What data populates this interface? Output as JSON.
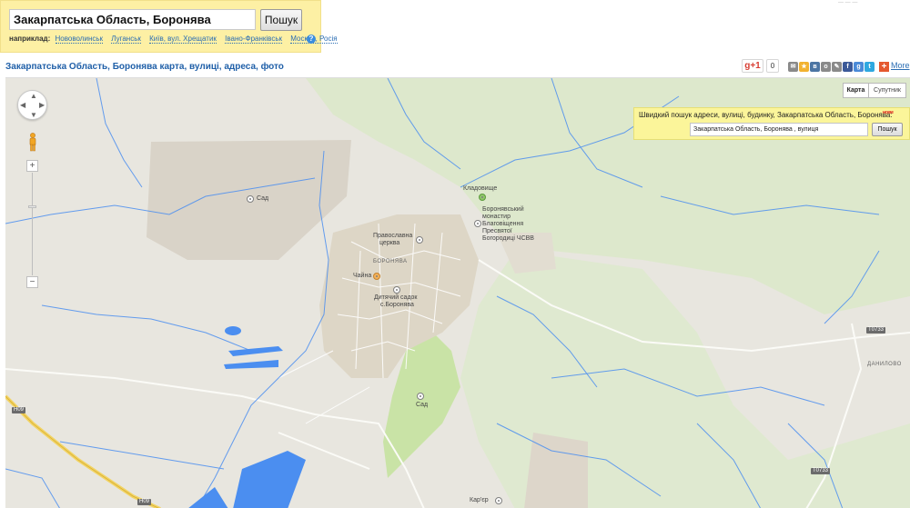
{
  "search": {
    "value": "Закарпатська Область, Боронява",
    "button_label": "Пошук",
    "examples_label": "наприклад:",
    "examples": [
      "Нововолинськ",
      "Луганськ",
      "Київ, вул. Хрещатик",
      "Івано-Франківськ",
      "Москва, Росія"
    ],
    "help_icon": "?"
  },
  "header": {
    "title": "Закарпатська Область, Боронява карта, вулиці, адреса, фото",
    "gplus_label": "g+1",
    "gplus_count": "0",
    "share_icons": [
      {
        "name": "mail-icon",
        "glyph": "✉",
        "color": "#8a8a8a"
      },
      {
        "name": "bookmark-icon",
        "glyph": "★",
        "color": "#f2b230"
      },
      {
        "name": "vk-icon",
        "glyph": "в",
        "color": "#4c75a3"
      },
      {
        "name": "odnoklassniki-icon",
        "glyph": "о",
        "color": "#8a8a8a"
      },
      {
        "name": "livejournal-icon",
        "glyph": "✎",
        "color": "#8a8a8a"
      },
      {
        "name": "facebook-icon",
        "glyph": "f",
        "color": "#3b5998"
      },
      {
        "name": "google-icon",
        "glyph": "g",
        "color": "#4a8ad8"
      },
      {
        "name": "twitter-icon",
        "glyph": "t",
        "color": "#2fa8e0"
      }
    ],
    "more_label": "More"
  },
  "map": {
    "type_map_label": "Карта",
    "type_satellite_label": "Супутник",
    "zoom_in_label": "+",
    "zoom_out_label": "−",
    "labels": {
      "garden_1": "Сад",
      "cemetery": "Кладовище",
      "monastery_1": "Боронявський",
      "monastery_2": "монастир",
      "monastery_3": "Благовіщення",
      "monastery_4": "Пресвятої",
      "monastery_5": "Богородиці ЧСВВ",
      "church_1": "Православна",
      "church_2": "церква",
      "town": "БОРОНЯВА",
      "teahouse": "Чайна",
      "kindergarten_1": "Дитячий садок",
      "kindergarten_2": "с.Боронява",
      "garden_2": "Сад",
      "quarry": "Кар'єр",
      "village": "ДАНИЛОВО",
      "road_t0733_a": "T0733",
      "road_t0733_b": "T0733",
      "road_h09_a": "H09",
      "road_h09_b": "H09"
    }
  },
  "quick_search": {
    "title": "Швидкий пошук адреси, вулиці, будинку, Закарпатська Область, Боронява:",
    "new_badge": "нове",
    "value": "Закарпатська Область, Боронява , вулиця",
    "button_label": "Пошук"
  },
  "colors": {
    "panel_yellow": "#fdf0a4",
    "title_blue": "#1f5fa8",
    "map_land": "#e8e6df",
    "map_water": "#4b8ef0",
    "map_forest": "#c9e3a6"
  }
}
